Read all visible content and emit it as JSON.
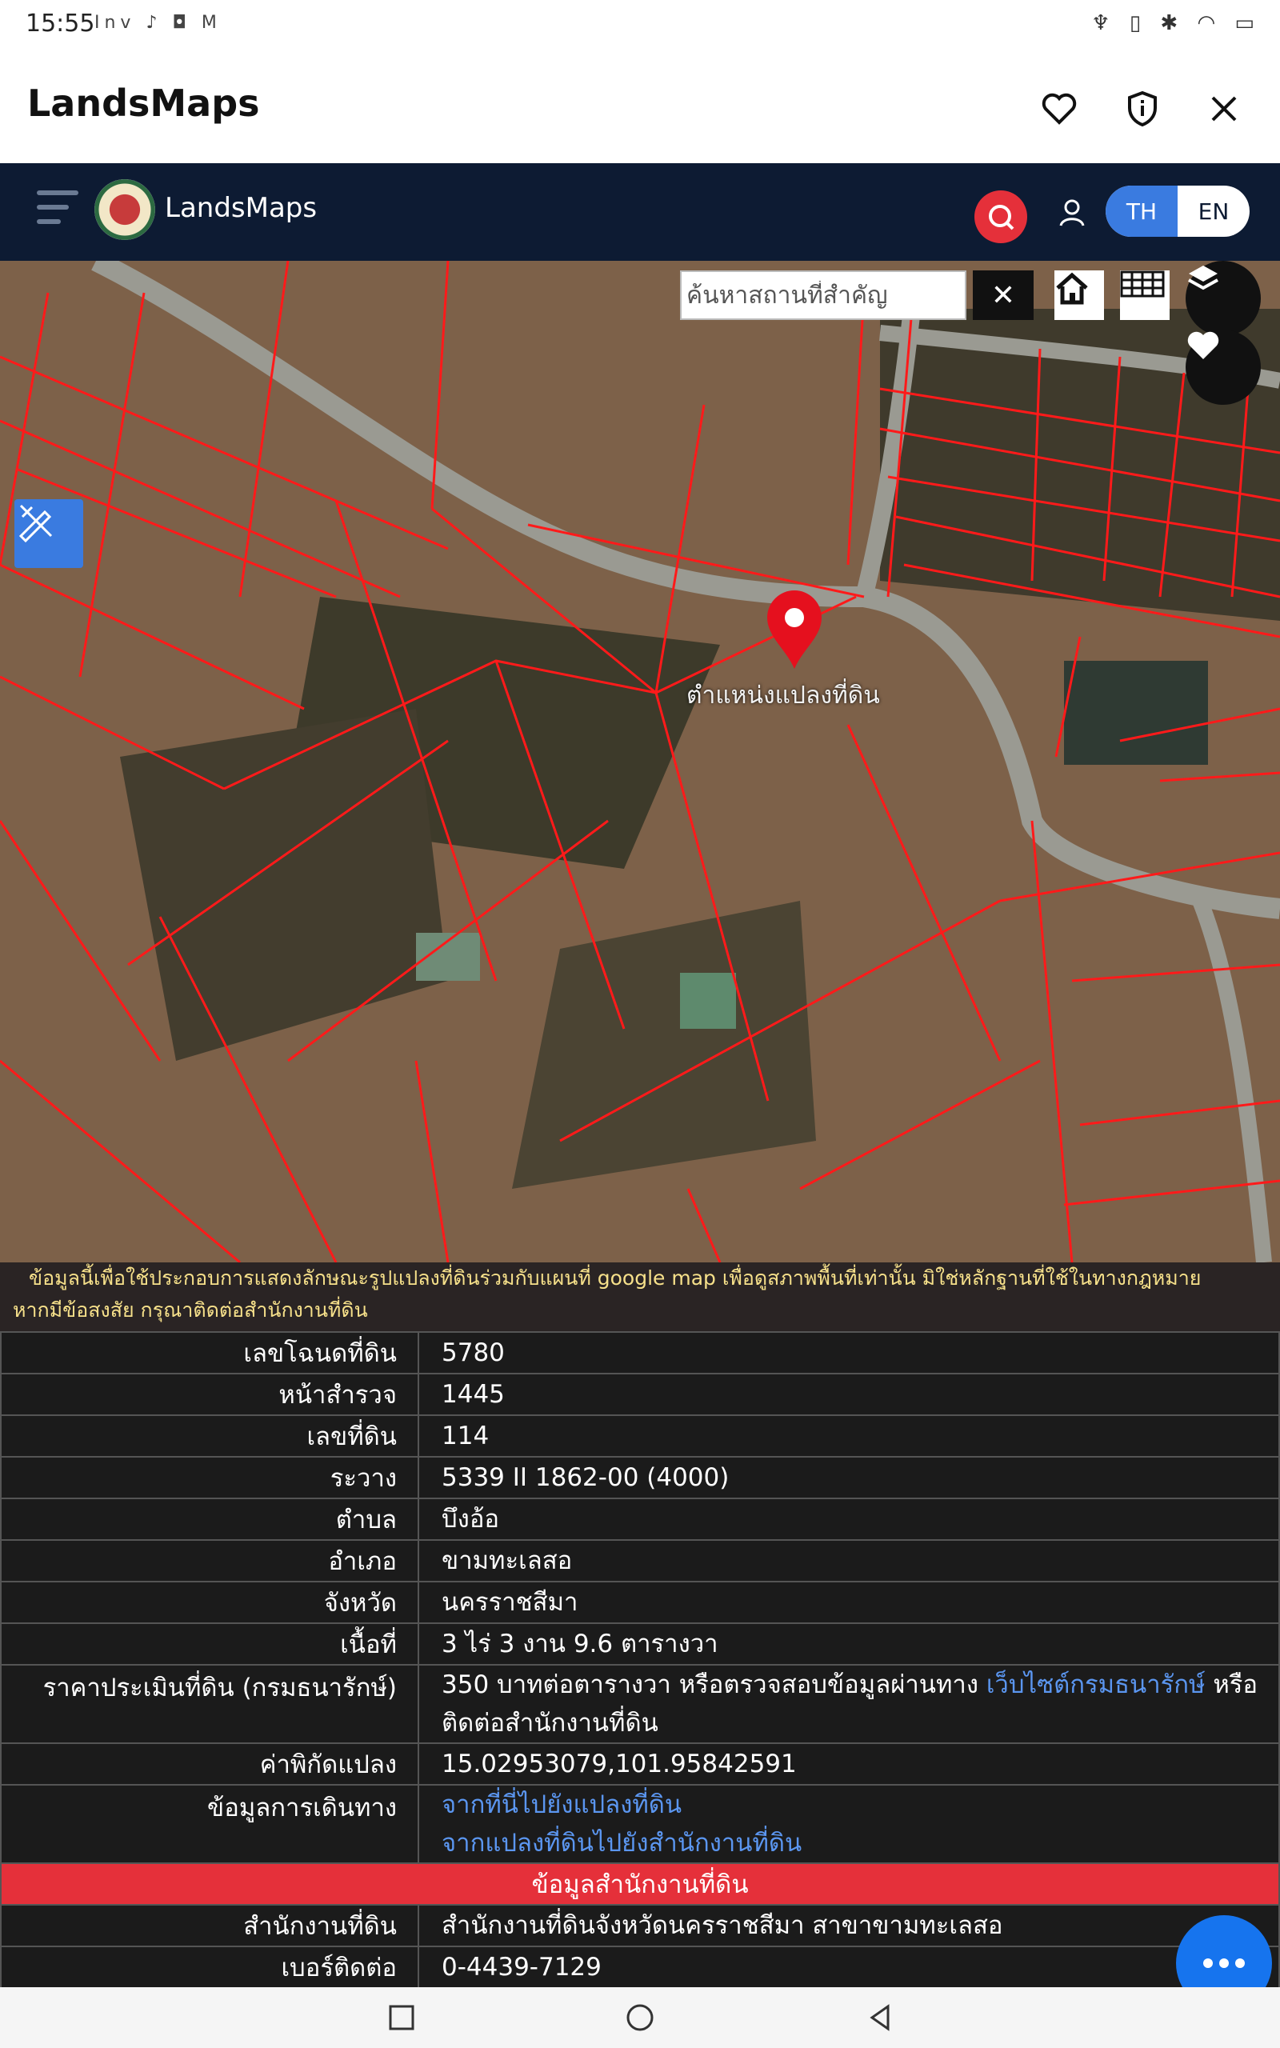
{
  "status": {
    "time": "15:55",
    "app_icons": "Inv ♪ ◘ M",
    "right_icons": "♆ ▯ ✱ ◠ ▭"
  },
  "app": {
    "title": "LandsMaps"
  },
  "header": {
    "site_name": "LandsMaps",
    "lang_th": "TH",
    "lang_en": "EN"
  },
  "map": {
    "search_placeholder": "ค้นหาสถานที่สำคัญ",
    "clear_label": "✕",
    "marker_label": "ตำแหน่งแปลงที่ดิน"
  },
  "panel": {
    "disclaimer_line1": "ข้อมูลนี้เพื่อใช้ประกอบการแสดงลักษณะรูปแปลงที่ดินร่วมกับแผนที่ google map เพื่อดูสภาพพื้นที่เท่านั้น มิใช่หลักฐานที่ใช้ในทางกฎหมาย",
    "disclaimer_line2": "หากมีข้อสงสัย กรุณาติดต่อสำนักงานที่ดิน",
    "rows": [
      {
        "label": "เลขโฉนดที่ดิน",
        "value": "5780"
      },
      {
        "label": "หน้าสำรวจ",
        "value": "1445"
      },
      {
        "label": "เลขที่ดิน",
        "value": "114"
      },
      {
        "label": "ระวาง",
        "value": "5339 II 1862-00 (4000)"
      },
      {
        "label": "ตำบล",
        "value": "บึงอ้อ"
      },
      {
        "label": "อำเภอ",
        "value": "ขามทะเลสอ"
      },
      {
        "label": "จังหวัด",
        "value": "นครราชสีมา"
      },
      {
        "label": "เนื้อที่",
        "value": "3 ไร่ 3 งาน 9.6 ตารางวา"
      }
    ],
    "price_label": "ราคาประเมินที่ดิน (กรมธนารักษ์)",
    "price_text1": "350 บาทต่อตารางวา หรือตรวจสอบข้อมูลผ่านทาง ",
    "price_link": "เว็บไซต์กรมธนารักษ์",
    "price_text2": " หรือ",
    "price_text3": "ติดต่อสำนักงานที่ดิน",
    "coord_label": "ค่าพิกัดแปลง",
    "coord_value": "15.02953079,101.95842591",
    "travel_label": "ข้อมูลการเดินทาง",
    "travel_link1": "จากที่นี่ไปยังแปลงที่ดิน",
    "travel_link2": "จากแปลงที่ดินไปยังสำนักงานที่ดิน",
    "office_header": "ข้อมูลสำนักงานที่ดิน",
    "office_label": "สำนักงานที่ดิน",
    "office_value": "สำนักงานที่ดินจังหวัดนครราชสีมา สาขาขามทะเลสอ",
    "phone_label": "เบอร์ติดต่อ",
    "phone_value": "0-4439-7129"
  },
  "colors": {
    "header_bg": "#0d1b33",
    "accent_red": "#e5303a",
    "accent_blue": "#3a7be0",
    "link_blue": "#5b96f0",
    "disclaimer_yellow": "#f6e08a"
  }
}
